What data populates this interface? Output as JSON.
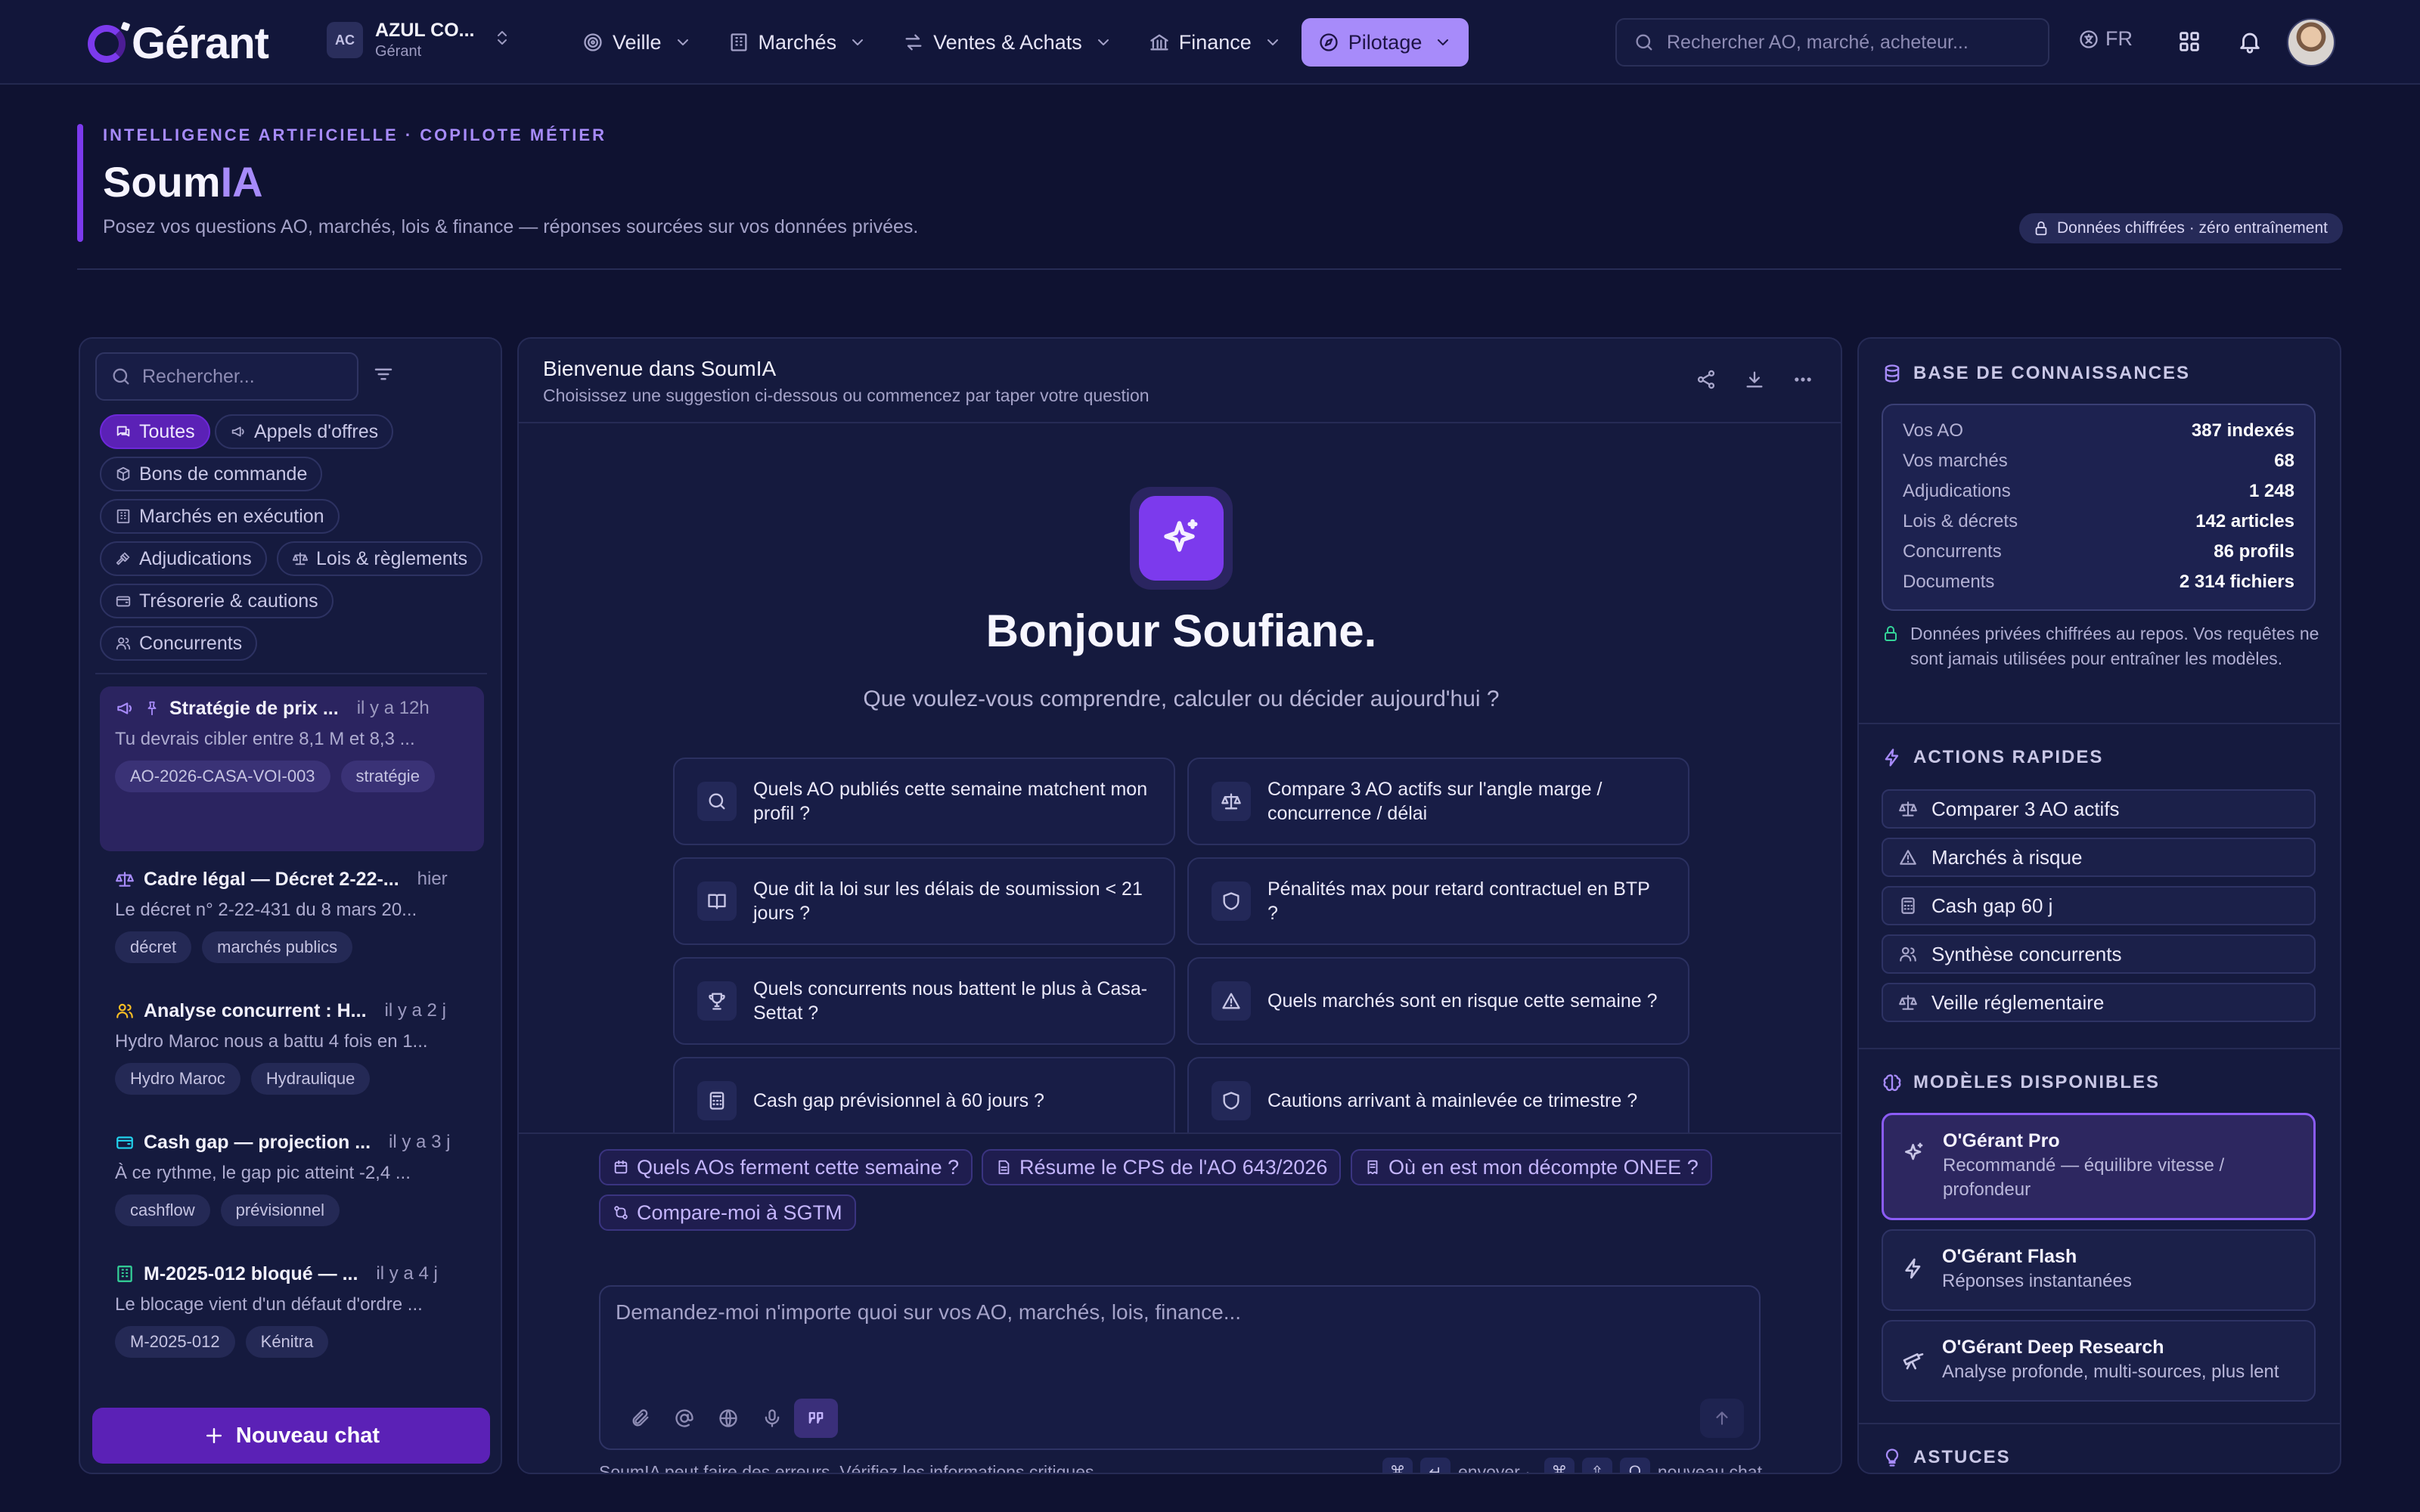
{
  "brand": {
    "name": "Gérant"
  },
  "org": {
    "initials": "AC",
    "name": "AZUL CO...",
    "role": "Gérant"
  },
  "nav": [
    {
      "label": "Veille",
      "icon": "radar-icon"
    },
    {
      "label": "Marchés",
      "icon": "building-icon"
    },
    {
      "label": "Ventes & Achats",
      "icon": "arrows-icon"
    },
    {
      "label": "Finance",
      "icon": "bank-icon"
    },
    {
      "label": "Pilotage",
      "icon": "compass-icon",
      "active": true
    }
  ],
  "top_search": {
    "placeholder": "Rechercher AO, marché, acheteur..."
  },
  "language": "FR",
  "header": {
    "eyebrow": "INTELLIGENCE ARTIFICIELLE · COPILOTE MÉTIER",
    "title_a": "Soum",
    "title_b": "IA",
    "subtitle": "Posez vos questions AO, marchés, lois & finance — réponses sourcées sur vos données privées.",
    "privacy_badge": "Données chiffrées · zéro entraînement"
  },
  "sidebar": {
    "search_placeholder": "Rechercher...",
    "filters": [
      {
        "label": "Toutes",
        "icon": "chat-icon",
        "active": true
      },
      {
        "label": "Appels d'offres",
        "icon": "megaphone-icon"
      },
      {
        "label": "Bons de commande",
        "icon": "box-icon"
      },
      {
        "label": "Marchés en exécution",
        "icon": "building-icon"
      },
      {
        "label": "Adjudications",
        "icon": "gavel-icon"
      },
      {
        "label": "Lois & règlements",
        "icon": "scale-icon"
      },
      {
        "label": "Trésorerie & cautions",
        "icon": "wallet-icon"
      },
      {
        "label": "Concurrents",
        "icon": "users-icon"
      }
    ],
    "conversations": [
      {
        "title": "Stratégie de prix ...",
        "time": "il y a 12h",
        "preview": "Tu devrais cibler entre 8,1 M et 8,3 ...",
        "tags": [
          "AO-2026-CASA-VOI-003",
          "stratégie"
        ],
        "icon": "megaphone-icon",
        "pinned": true,
        "selected": true
      },
      {
        "title": "Cadre légal — Décret 2-22-...",
        "time": "hier",
        "preview": "Le décret n° 2-22-431 du 8 mars 20...",
        "tags": [
          "décret",
          "marchés publics"
        ],
        "icon": "scale-icon"
      },
      {
        "title": "Analyse concurrent : H...",
        "time": "il y a 2 j",
        "preview": "Hydro Maroc nous a battu 4 fois en 1...",
        "tags": [
          "Hydro Maroc",
          "Hydraulique"
        ],
        "icon": "users-icon"
      },
      {
        "title": "Cash gap — projection ...",
        "time": "il y a 3 j",
        "preview": "À ce rythme, le gap pic atteint -2,4 ...",
        "tags": [
          "cashflow",
          "prévisionnel"
        ],
        "icon": "wallet-icon"
      },
      {
        "title": "M-2025-012 bloqué — ...",
        "time": "il y a 4 j",
        "preview": "Le blocage vient d'un défaut d'ordre ...",
        "tags": [
          "M-2025-012",
          "Kénitra"
        ],
        "icon": "building-icon"
      }
    ],
    "new_chat": "Nouveau chat"
  },
  "chat": {
    "title": "Bienvenue dans SoumIA",
    "subtitle": "Choisissez une suggestion ci-dessous ou commencez par taper votre question",
    "greeting": "Bonjour Soufiane.",
    "question": "Que voulez-vous comprendre, calculer ou décider aujourd'hui ?",
    "suggestions": [
      {
        "text": "Quels AO publiés cette semaine matchent mon profil ?",
        "icon": "search-icon"
      },
      {
        "text": "Compare 3 AO actifs sur l'angle marge / concurrence / délai",
        "icon": "scale-icon"
      },
      {
        "text": "Que dit la loi sur les délais de soumission < 21 jours ?",
        "icon": "book-icon"
      },
      {
        "text": "Pénalités max pour retard contractuel en BTP ?",
        "icon": "shield-icon"
      },
      {
        "text": "Quels concurrents nous battent le plus à Casa-Settat ?",
        "icon": "trophy-icon"
      },
      {
        "text": "Quels marchés sont en risque cette semaine ?",
        "icon": "warning-icon"
      },
      {
        "text": "Cash gap prévisionnel à 60 jours ?",
        "icon": "calculator-icon"
      },
      {
        "text": "Cautions arrivant à mainlevée ce trimestre ?",
        "icon": "shield-icon"
      }
    ],
    "quick_prompts": [
      {
        "text": "Quels AOs ferment cette semaine ?",
        "icon": "calendar-icon"
      },
      {
        "text": "Résume le CPS de l'AO 643/2026",
        "icon": "file-icon"
      },
      {
        "text": "Où en est mon décompte ONEE ?",
        "icon": "receipt-icon"
      },
      {
        "text": "Compare-moi à SGTM",
        "icon": "compare-icon"
      }
    ],
    "input_placeholder": "Demandez-moi n'importe quoi sur vos AO, marchés, lois, finance...",
    "disclaimer": "SoumIA peut faire des erreurs. Vérifiez les informations critiques.",
    "shortcut_send": "envoyer ·",
    "shortcut_new": "nouveau chat",
    "key_cmd": "⌘",
    "key_enter": "↵",
    "key_shift": "⇧",
    "key_o": "O"
  },
  "knowledge": {
    "title": "BASE DE CONNAISSANCES",
    "rows": [
      {
        "k": "Vos AO",
        "v": "387 indexés"
      },
      {
        "k": "Vos marchés",
        "v": "68"
      },
      {
        "k": "Adjudications",
        "v": "1 248"
      },
      {
        "k": "Lois & décrets",
        "v": "142 articles"
      },
      {
        "k": "Concurrents",
        "v": "86 profils"
      },
      {
        "k": "Documents",
        "v": "2 314 fichiers"
      }
    ],
    "note": "Données privées chiffrées au repos. Vos requêtes ne sont jamais utilisées pour entraîner les modèles."
  },
  "quick_actions": {
    "title": "ACTIONS RAPIDES",
    "items": [
      {
        "label": "Comparer 3 AO actifs",
        "icon": "scale-icon"
      },
      {
        "label": "Marchés à risque",
        "icon": "warning-icon"
      },
      {
        "label": "Cash gap 60 j",
        "icon": "calculator-icon"
      },
      {
        "label": "Synthèse concurrents",
        "icon": "users-icon"
      },
      {
        "label": "Veille réglementaire",
        "icon": "scale-icon"
      }
    ]
  },
  "models": {
    "title": "MODÈLES DISPONIBLES",
    "items": [
      {
        "name": "O'Gérant Pro",
        "desc": "Recommandé — équilibre vitesse / profondeur",
        "icon": "sparkles-icon",
        "selected": true
      },
      {
        "name": "O'Gérant Flash",
        "desc": "Réponses instantanées",
        "icon": "bolt-icon"
      },
      {
        "name": "O'Gérant Deep Research",
        "desc": "Analyse profonde, multi-sources, plus lent",
        "icon": "telescope-icon"
      }
    ]
  },
  "tips": {
    "title": "ASTUCES"
  },
  "colors": {
    "accent": "#7c3aed",
    "accent_light": "#a78bfa",
    "bg": "#0f1231",
    "panel": "#151a3e",
    "success": "#34d399"
  }
}
